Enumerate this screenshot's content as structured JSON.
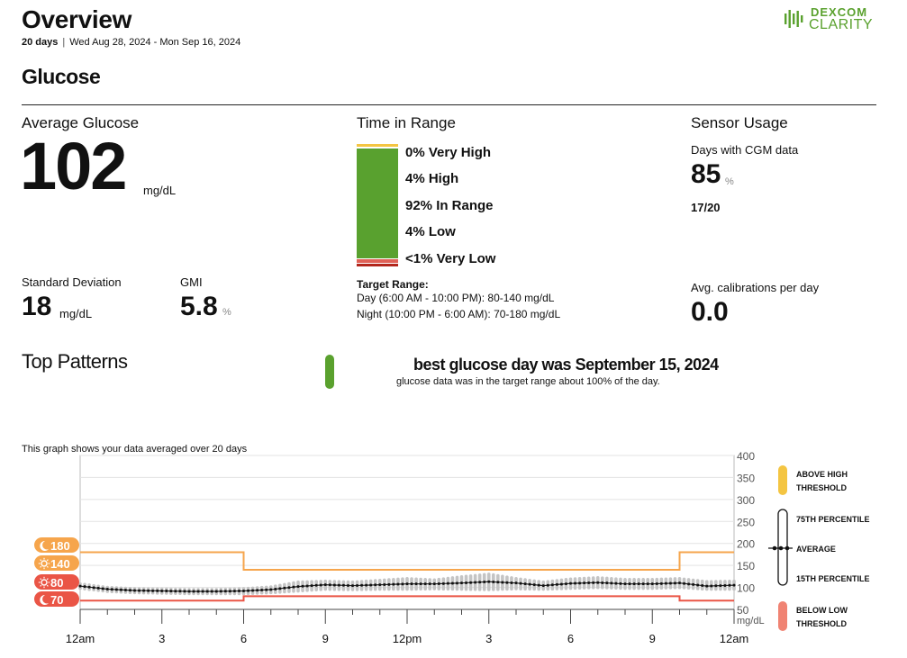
{
  "header": {
    "title": "Overview",
    "days": "20 days",
    "separator": "|",
    "date_range": "Wed Aug 28, 2024 - Mon Sep 16, 2024",
    "logo_word1": "DEXCOM",
    "logo_word2": "CLARITY"
  },
  "section_title": "Glucose",
  "average_glucose": {
    "label": "Average Glucose",
    "value": "102",
    "unit": "mg/dL"
  },
  "standard_deviation": {
    "label": "Standard Deviation",
    "value": "18",
    "unit": "mg/dL"
  },
  "gmi": {
    "label": "GMI",
    "value": "5.8",
    "unit": "%"
  },
  "time_in_range": {
    "label": "Time in Range",
    "rows": [
      {
        "text": "0% Very High",
        "pct": 0,
        "color": "#f4c542"
      },
      {
        "text": "4% High",
        "pct": 4,
        "color": "#f4c542"
      },
      {
        "text": "92% In Range",
        "pct": 92,
        "color": "#59a12f"
      },
      {
        "text": "4% Low",
        "pct": 4,
        "color": "#e06157"
      },
      {
        "text": "<1% Very Low",
        "pct": 1,
        "color": "#b2261c"
      }
    ],
    "target_label": "Target Range:",
    "target_day": "Day (6:00 AM - 10:00 PM): 80-140 mg/dL",
    "target_night": "Night (10:00 PM - 6:00 AM): 70-180 mg/dL"
  },
  "sensor_usage": {
    "label": "Sensor Usage",
    "days_label": "Days with CGM data",
    "days_value": "85",
    "days_unit": "%",
    "days_fraction": "17/20",
    "calibrations_label": "Avg. calibrations per day",
    "calibrations_value": "0.0"
  },
  "top_patterns": {
    "label": "Top Patterns",
    "headline": "best glucose day was September 15, 2024",
    "detail": "glucose data was in the target range about 100% of the day."
  },
  "agp": {
    "caption": "This graph shows your data averaged over 20 days",
    "legend": {
      "above_high": "ABOVE HIGH THRESHOLD",
      "p75": "75TH PERCENTILE",
      "average": "AVERAGE",
      "p15": "15TH PERCENTILE",
      "below_low": "BELOW LOW THRESHOLD"
    },
    "threshold_badges": [
      {
        "icon": "moon-icon",
        "value": "180",
        "color": "#f6a54c"
      },
      {
        "icon": "sun-icon",
        "value": "140",
        "color": "#f6a54c"
      },
      {
        "icon": "sun-icon",
        "value": "80",
        "color": "#ea5546"
      },
      {
        "icon": "moon-icon",
        "value": "70",
        "color": "#ea5546"
      }
    ]
  },
  "chart_data": {
    "type": "line",
    "title": "",
    "xlabel": "",
    "ylabel": "mg/dL",
    "x_tick_labels": [
      "12am",
      "3",
      "6",
      "9",
      "12pm",
      "3",
      "6",
      "9",
      "12am"
    ],
    "x_range_hours": [
      0,
      24
    ],
    "y_tick_labels": [
      "400",
      "350",
      "300",
      "250",
      "200",
      "150",
      "100",
      "50"
    ],
    "ylim": [
      50,
      400
    ],
    "grid": true,
    "high_threshold": {
      "segments": [
        {
          "from_hour": 0,
          "to_hour": 6,
          "value": 180
        },
        {
          "from_hour": 6,
          "to_hour": 22,
          "value": 140
        },
        {
          "from_hour": 22,
          "to_hour": 24,
          "value": 180
        }
      ],
      "color": "#f6a54c"
    },
    "low_threshold": {
      "segments": [
        {
          "from_hour": 0,
          "to_hour": 6,
          "value": 70
        },
        {
          "from_hour": 6,
          "to_hour": 22,
          "value": 80
        },
        {
          "from_hour": 22,
          "to_hour": 24,
          "value": 70
        }
      ],
      "color": "#ea5546"
    },
    "series": [
      {
        "name": "AVERAGE",
        "x_hours": [
          0,
          1,
          2,
          3,
          4,
          5,
          6,
          7,
          8,
          9,
          10,
          11,
          12,
          13,
          14,
          15,
          16,
          17,
          18,
          19,
          20,
          21,
          22,
          23,
          24
        ],
        "values": [
          103,
          96,
          93,
          92,
          91,
          91,
          92,
          95,
          102,
          106,
          104,
          106,
          108,
          108,
          110,
          113,
          110,
          104,
          109,
          111,
          108,
          108,
          110,
          103,
          105
        ]
      },
      {
        "name": "75TH PERCENTILE",
        "x_hours": [
          0,
          1,
          2,
          3,
          4,
          5,
          6,
          7,
          8,
          9,
          10,
          11,
          12,
          13,
          14,
          15,
          16,
          17,
          18,
          19,
          20,
          21,
          22,
          23,
          24
        ],
        "values": [
          108,
          100,
          97,
          96,
          95,
          95,
          97,
          101,
          112,
          114,
          112,
          116,
          120,
          117,
          124,
          130,
          120,
          112,
          119,
          122,
          118,
          118,
          120,
          113,
          114
        ]
      },
      {
        "name": "15TH PERCENTILE",
        "x_hours": [
          0,
          1,
          2,
          3,
          4,
          5,
          6,
          7,
          8,
          9,
          10,
          11,
          12,
          13,
          14,
          15,
          16,
          17,
          18,
          19,
          20,
          21,
          22,
          23,
          24
        ],
        "values": [
          98,
          91,
          88,
          87,
          86,
          86,
          86,
          88,
          92,
          96,
          95,
          96,
          96,
          97,
          96,
          95,
          97,
          96,
          98,
          100,
          98,
          98,
          100,
          96,
          96
        ]
      }
    ]
  }
}
